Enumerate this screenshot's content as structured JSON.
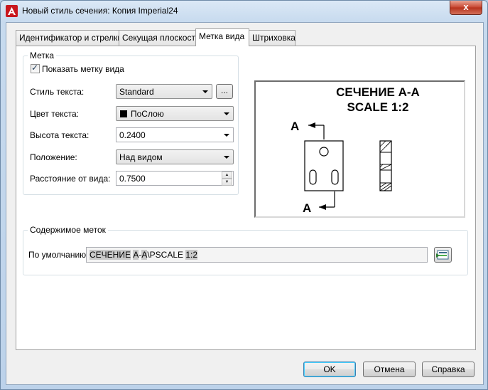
{
  "window": {
    "title": "Новый стиль сечения: Копия Imperial24",
    "close_glyph": "x"
  },
  "tabs": [
    {
      "label": "Идентификатор и стрелки",
      "active": false
    },
    {
      "label": "Секущая плоскость",
      "active": false
    },
    {
      "label": "Метка вида",
      "active": true
    },
    {
      "label": "Штриховка",
      "active": false
    }
  ],
  "label_group": {
    "title": "Метка",
    "show_label": {
      "label": "Показать метку вида",
      "checked": true
    },
    "text_style": {
      "label": "Стиль текста:",
      "value": "Standard",
      "browse_label": "..."
    },
    "text_color": {
      "label": "Цвет текста:",
      "value": "ПоСлою",
      "swatch_color": "#000000"
    },
    "text_height": {
      "label": "Высота текста:",
      "value": "0.2400"
    },
    "position": {
      "label": "Положение:",
      "value": "Над видом"
    },
    "offset": {
      "label": "Расстояние от вида:",
      "value": "0.7500"
    }
  },
  "preview": {
    "title_line1": "СЕЧЕНИЕ A-A",
    "title_line2": "SCALE 1:2",
    "label_top": "A",
    "label_bottom": "A"
  },
  "contents_group": {
    "title": "Содержимое меток",
    "default_label": "По умолчанию:",
    "default_value_parts": [
      {
        "text": "СЕЧЕНИЕ",
        "field": true
      },
      {
        "text": " ",
        "field": false
      },
      {
        "text": "A",
        "field": true
      },
      {
        "text": "-",
        "field": false
      },
      {
        "text": "A",
        "field": true
      },
      {
        "text": "\\PSCALE ",
        "field": false
      },
      {
        "text": "1:2",
        "field": true
      }
    ],
    "insert_field_icon": "insert-field-icon"
  },
  "buttons": {
    "ok": "OK",
    "cancel": "Отмена",
    "help": "Справка"
  },
  "colors": {
    "accent_border": "#3c7fb1",
    "field_highlight": "#c9c9c9"
  }
}
